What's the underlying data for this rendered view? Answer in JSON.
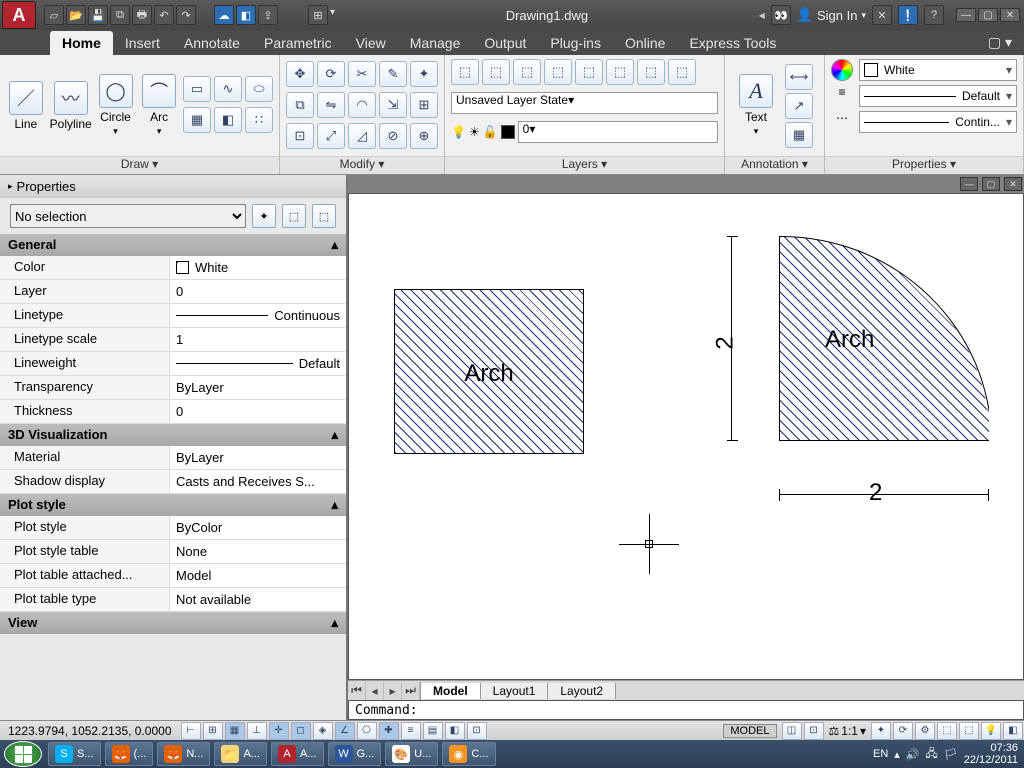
{
  "app": {
    "title": "Drawing1.dwg",
    "signin": "Sign In"
  },
  "tabs": [
    "Home",
    "Insert",
    "Annotate",
    "Parametric",
    "View",
    "Manage",
    "Output",
    "Plug-ins",
    "Online",
    "Express Tools"
  ],
  "active_tab": 0,
  "ribbon": {
    "draw": {
      "title": "Draw ▾",
      "tools": [
        "Line",
        "Polyline",
        "Circle",
        "Arc"
      ]
    },
    "modify": {
      "title": "Modify ▾"
    },
    "layers": {
      "title": "Layers ▾",
      "state": "Unsaved Layer State",
      "current": "0"
    },
    "annotation": {
      "title": "Annotation ▾",
      "text": "Text"
    },
    "properties": {
      "title": "Properties ▾",
      "color": "White",
      "lineweight": "Default",
      "linetype": "Contin..."
    }
  },
  "palette": {
    "title": "Properties",
    "selector": "No selection",
    "sections": {
      "general": {
        "title": "General",
        "rows": [
          {
            "k": "Color",
            "v": "White",
            "swatch": "#fff",
            "border": true
          },
          {
            "k": "Layer",
            "v": "0"
          },
          {
            "k": "Linetype",
            "v": "Continuous",
            "line": true
          },
          {
            "k": "Linetype scale",
            "v": "1"
          },
          {
            "k": "Lineweight",
            "v": "Default",
            "line": true
          },
          {
            "k": "Transparency",
            "v": "ByLayer"
          },
          {
            "k": "Thickness",
            "v": "0"
          }
        ]
      },
      "viz": {
        "title": "3D Visualization",
        "rows": [
          {
            "k": "Material",
            "v": "ByLayer"
          },
          {
            "k": "Shadow display",
            "v": "Casts and Receives S..."
          }
        ]
      },
      "plot": {
        "title": "Plot style",
        "rows": [
          {
            "k": "Plot style",
            "v": "ByColor"
          },
          {
            "k": "Plot style table",
            "v": "None"
          },
          {
            "k": "Plot table attached...",
            "v": "Model"
          },
          {
            "k": "Plot table type",
            "v": "Not available"
          }
        ]
      },
      "view": {
        "title": "View"
      }
    }
  },
  "canvas": {
    "shapes": {
      "square_label": "Arch",
      "arc_label": "Arch",
      "dim_v": "2",
      "dim_h": "2"
    },
    "tabs": [
      "Model",
      "Layout1",
      "Layout2"
    ],
    "command": "Command:"
  },
  "status": {
    "coords": "1223.9794, 1052.2135, 0.0000",
    "model": "MODEL",
    "scale": "1:1"
  },
  "taskbar": {
    "items": [
      "S...",
      "(...",
      "N...",
      "A...",
      "A...",
      "G...",
      "U...",
      "C..."
    ],
    "lang": "EN",
    "time": "07:36",
    "date": "22/12/2011"
  }
}
